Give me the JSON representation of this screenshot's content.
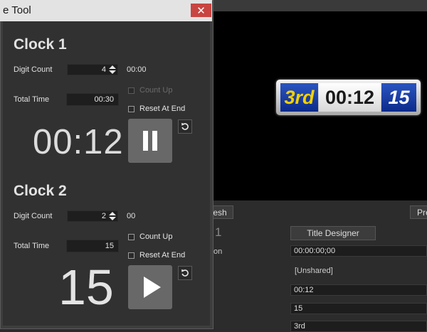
{
  "window": {
    "title": "e Tool",
    "close_glyph": "✕"
  },
  "clock1": {
    "heading": "Clock 1",
    "digit_count_label": "Digit Count",
    "digit_count": "4",
    "format_preview": "00:00",
    "total_time_label": "Total Time",
    "total_time": "00:30",
    "count_up_label": "Count Up",
    "count_up_checked": false,
    "count_up_enabled": false,
    "reset_at_end_label": "Reset At End",
    "reset_at_end_checked": false,
    "display": "00:12",
    "control_state": "pause",
    "control_icon": "pause-icon",
    "reset_icon": "reset-icon"
  },
  "clock2": {
    "heading": "Clock 2",
    "digit_count_label": "Digit Count",
    "digit_count": "2",
    "format_preview": "00",
    "total_time_label": "Total Time",
    "total_time": "15",
    "count_up_label": "Count Up",
    "count_up_checked": false,
    "count_up_enabled": true,
    "reset_at_end_label": "Reset At End",
    "reset_at_end_checked": false,
    "display": "15",
    "control_state": "play",
    "control_icon": "play-icon",
    "reset_icon": "reset-icon"
  },
  "preview": {
    "scorebug_left": "3rd",
    "scorebug_middle": "00:12",
    "scorebug_right": "15",
    "colors": {
      "bug_blue": "#0c2a8a",
      "bug_yellow": "#f5d000"
    }
  },
  "background": {
    "refresh_button": "esh",
    "pre_button": "Pre",
    "index_text": "1",
    "title_designer_button": "Title Designer",
    "duration_label": "on",
    "duration_value": "00:00:00;00",
    "unshared_text": "[Unshared]",
    "field_clock": "00:12",
    "field_count": "15",
    "field_period": "3rd"
  },
  "colors": {
    "close_red": "#c84541",
    "panel_bg": "#313131"
  }
}
